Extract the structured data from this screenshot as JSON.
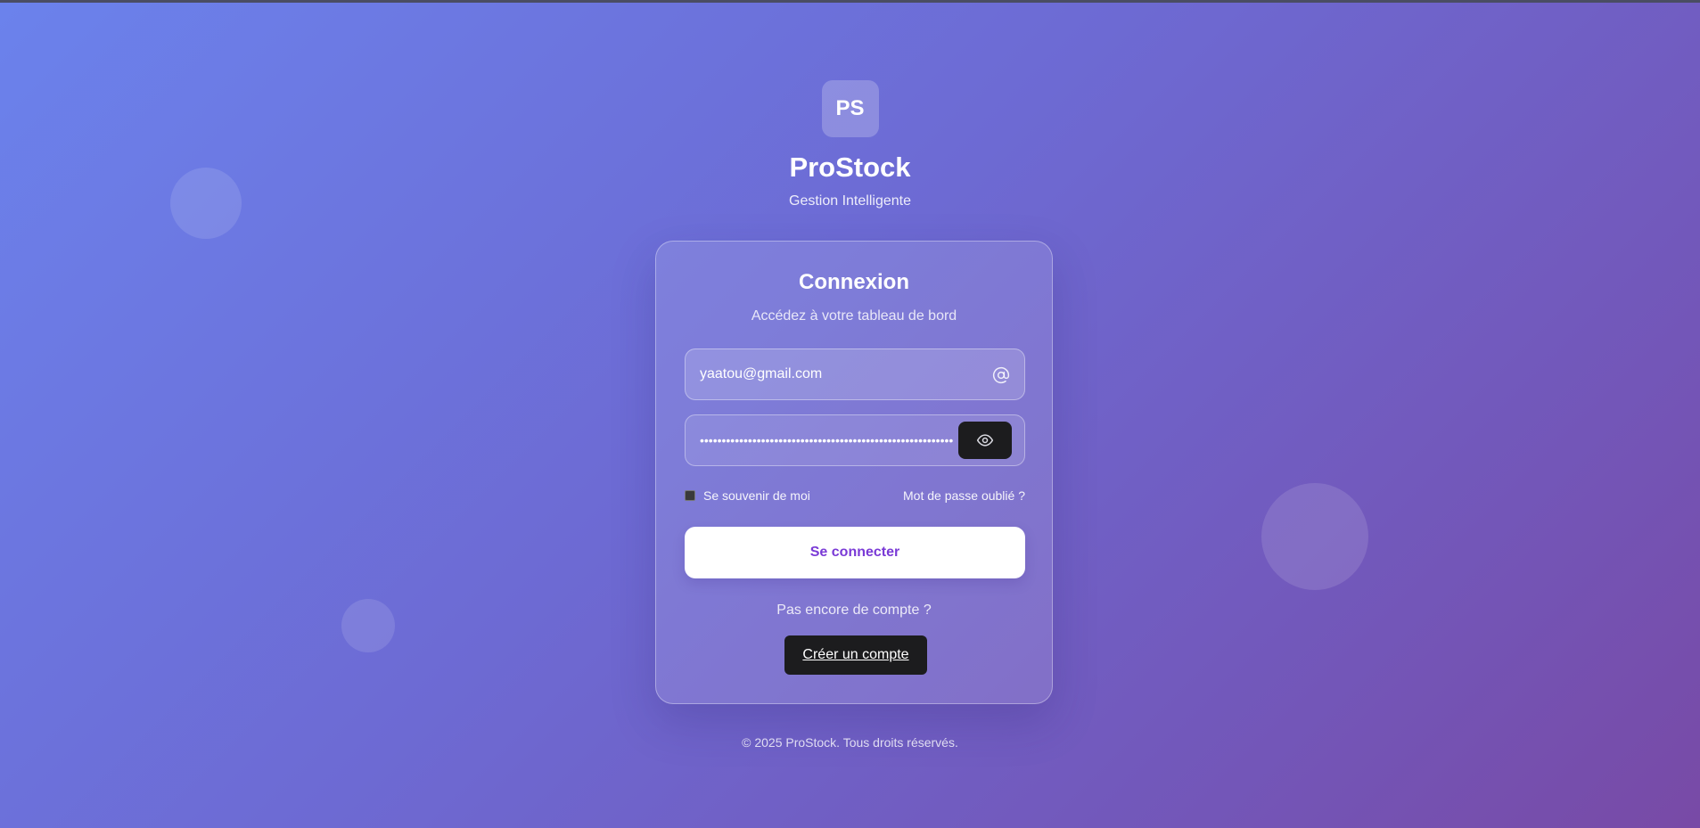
{
  "brand": {
    "logo_text": "PS",
    "name": "ProStock",
    "tagline": "Gestion Intelligente"
  },
  "login": {
    "title": "Connexion",
    "subtitle": "Accédez à votre tableau de bord",
    "email_value": "yaatou@gmail.com",
    "email_icon": "at-sign-icon",
    "password_value": "••••••••••••••••••••••••••••••••••••••••••••••••••••••••••",
    "password_toggle_icon": "eye-icon",
    "remember_label": "Se souvenir de moi",
    "remember_checked": false,
    "forgot_label": "Mot de passe oublié ?",
    "submit_label": "Se connecter",
    "no_account_label": "Pas encore de compte ?",
    "create_account_label": "Créer un compte"
  },
  "footer": {
    "text": "© 2025 ProStock. Tous droits réservés."
  },
  "colors": {
    "gradient_start": "#6b82ec",
    "gradient_end": "#784aa6",
    "submit_text": "#7a3ad6",
    "dark_button": "#1c1c1e"
  }
}
